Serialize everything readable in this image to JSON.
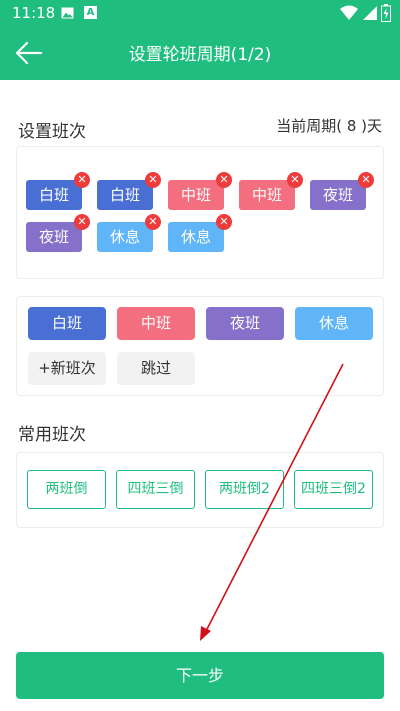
{
  "status_bar": {
    "time": "11:18",
    "icons": [
      "image-icon",
      "a-icon",
      "wifi-icon",
      "signal-icon",
      "battery-icon"
    ]
  },
  "header": {
    "title": "设置轮班周期(1/2)",
    "back_icon": "arrow-left-icon"
  },
  "shift_section": {
    "title": "设置班次",
    "cycle_text": "当前周期( 8 )天"
  },
  "selected_shifts": [
    {
      "label": "白班",
      "color": "#4a6fd4"
    },
    {
      "label": "白班",
      "color": "#4a6fd4"
    },
    {
      "label": "中班",
      "color": "#f36e7f"
    },
    {
      "label": "中班",
      "color": "#f36e7f"
    },
    {
      "label": "夜班",
      "color": "#8571c9"
    },
    {
      "label": "夜班",
      "color": "#8571c9"
    },
    {
      "label": "休息",
      "color": "#5fb5f7"
    },
    {
      "label": "休息",
      "color": "#5fb5f7"
    }
  ],
  "palette": {
    "shifts": [
      {
        "label": "白班",
        "color": "#4a6fd4"
      },
      {
        "label": "中班",
        "color": "#f36e7f"
      },
      {
        "label": "夜班",
        "color": "#8571c9"
      },
      {
        "label": "休息",
        "color": "#5fb5f7"
      }
    ],
    "new_shift_label": "+新班次",
    "skip_label": "跳过"
  },
  "common_section": {
    "title": "常用班次",
    "items": [
      "两班倒",
      "四班三倒",
      "两班倒2",
      "四班三倒2"
    ]
  },
  "next_button": "下一步",
  "colors": {
    "primary": "#1fbe7f",
    "remove": "#ee3b3b",
    "annotation_arrow": "#d0101a"
  }
}
